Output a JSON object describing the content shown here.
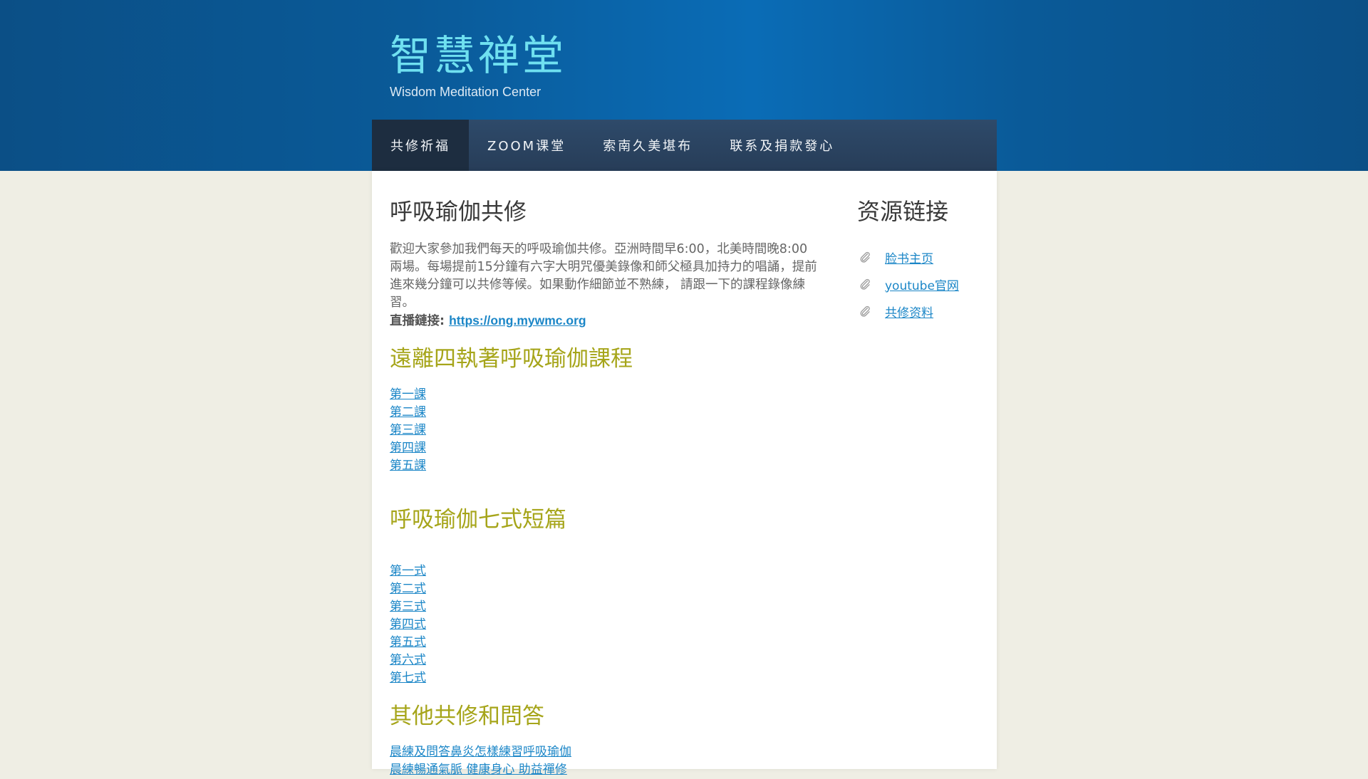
{
  "site": {
    "title": "智慧禅堂",
    "tagline": "Wisdom Meditation Center"
  },
  "nav": {
    "items": [
      {
        "label": "共修祈福",
        "active": true
      },
      {
        "label": "ZOOM课堂",
        "active": false
      },
      {
        "label": "索南久美堪布",
        "active": false
      },
      {
        "label": "联系及捐款發心",
        "active": false
      }
    ]
  },
  "post": {
    "title": "呼吸瑜伽共修",
    "intro": "歡迎大家參加我們每天的呼吸瑜伽共修。亞洲時間早6:00，北美時間晚8:00兩場。每場提前15分鐘有六字大明咒優美錄像和師父極具加持力的唱誦，提前進來幾分鐘可以共修等候。如果動作細節並不熟練， 請跟一下的課程錄像練習。",
    "live_label": "直播鏈接:",
    "live_url": "https://ong.mywmc.org"
  },
  "sections": [
    {
      "title": "遠離四執著呼吸瑜伽課程",
      "links": [
        "第一課",
        "第二課",
        "第三課",
        "第四課",
        "第五課"
      ]
    },
    {
      "title": "呼吸瑜伽七式短篇",
      "links": [
        "第一式",
        "第二式",
        "第三式",
        "第四式",
        "第五式",
        "第六式",
        "第七式"
      ]
    },
    {
      "title": "其他共修和問答",
      "links": [
        "晨練及問答鼻炎怎樣練習呼吸瑜伽",
        "晨練暢通氣脈 健康身心 助益禪修"
      ]
    }
  ],
  "sidebar": {
    "title": "资源链接",
    "links": [
      "脸书主页",
      "youtube官网",
      "共修资料"
    ],
    "icon": "paperclip-icon"
  },
  "colors": {
    "header": "#0a5a98",
    "nav": "#2b4463",
    "nav_active": "#1d2d40",
    "title": "#6fe0f0",
    "section": "#a6a51a",
    "link": "#1b86c7",
    "background": "#efeee4"
  }
}
